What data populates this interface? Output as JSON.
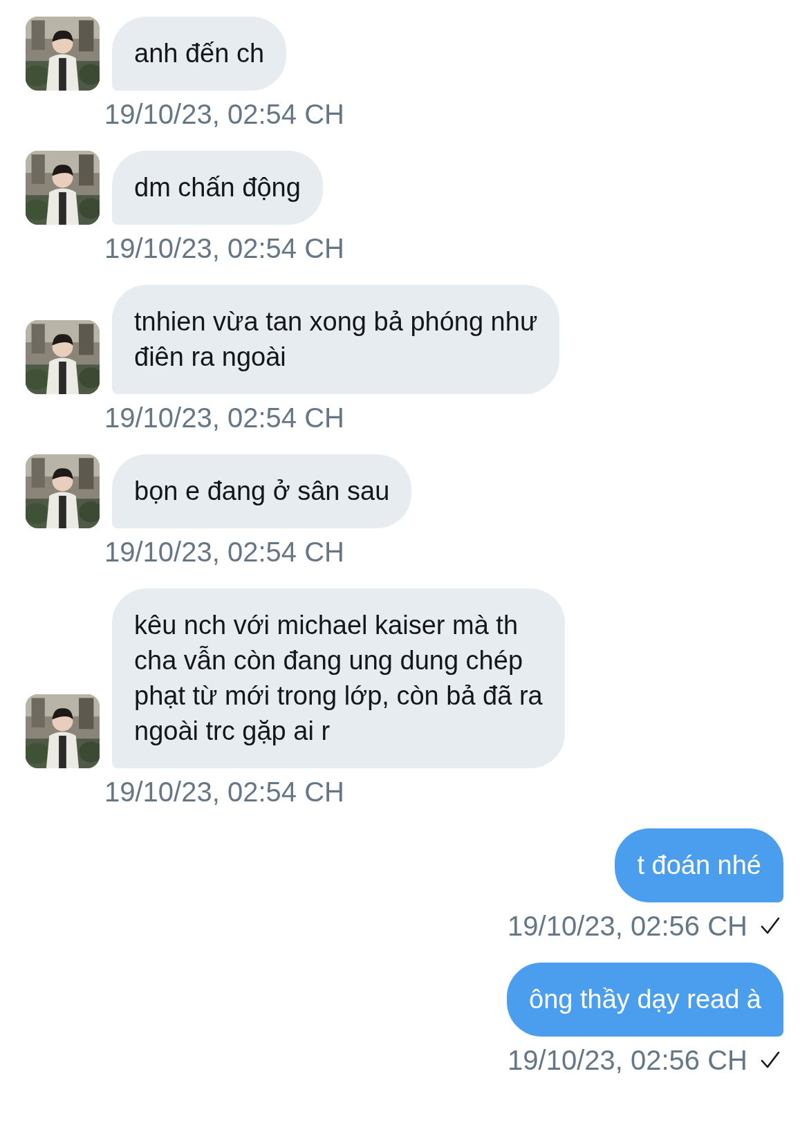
{
  "messages": [
    {
      "kind": "received",
      "text": "anh đến ch",
      "time": "19/10/23, 02:54 CH"
    },
    {
      "kind": "received",
      "text": "dm chấn động",
      "time": "19/10/23, 02:54 CH"
    },
    {
      "kind": "received",
      "text": "tnhien vừa tan xong bả phóng như\nđiên ra ngoài",
      "time": "19/10/23, 02:54 CH"
    },
    {
      "kind": "received",
      "text": "bọn e đang ở sân sau",
      "time": "19/10/23, 02:54 CH"
    },
    {
      "kind": "received",
      "text": "kêu nch với michael kaiser mà th\ncha vẫn còn đang ung dung chép\nphạt từ mới trong lớp, còn bả đã ra\nngoài trc gặp ai r",
      "time": "19/10/23, 02:54 CH"
    },
    {
      "kind": "sent",
      "text": "t đoán nhé",
      "time": "19/10/23, 02:56 CH",
      "delivered": true
    },
    {
      "kind": "sent",
      "text": "ông thầy dạy read à",
      "time": "19/10/23, 02:56 CH",
      "delivered": true
    }
  ]
}
